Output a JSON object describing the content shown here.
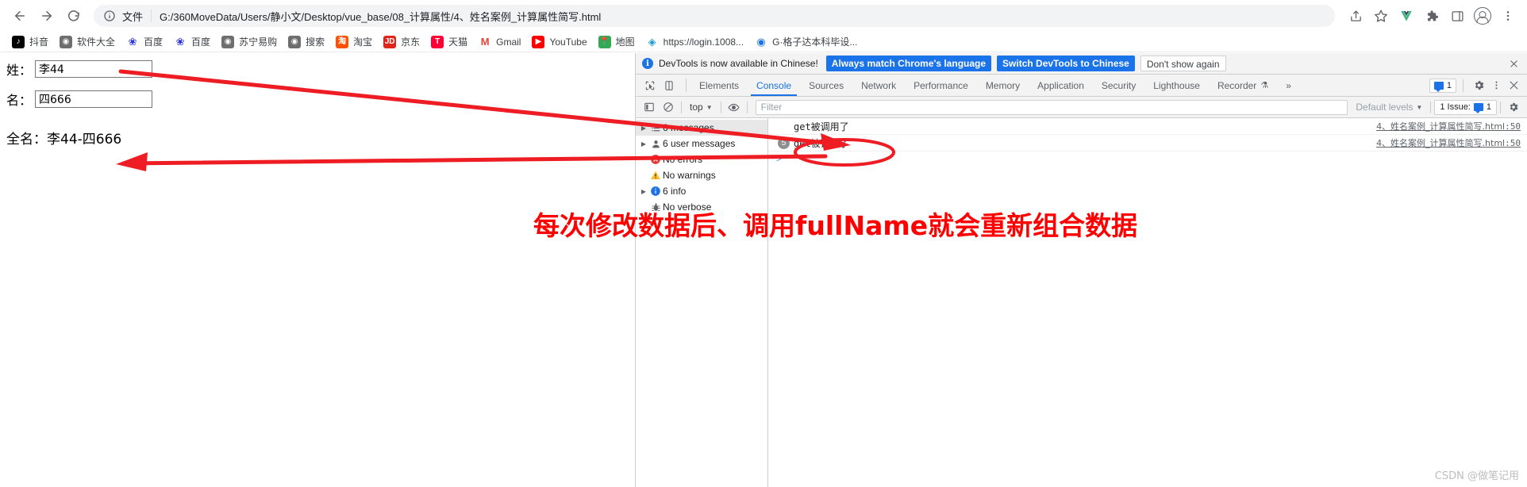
{
  "browser": {
    "nav": {
      "back_label": "Back",
      "forward_label": "Forward",
      "reload_label": "Reload"
    },
    "omnibox": {
      "scheme_label": "文件",
      "url": "G:/360MoveData/Users/静小文/Desktop/vue_base/08_计算属性/4、姓名案例_计算属性简写.html",
      "info_icon": "info-circle-icon"
    },
    "toolbar_right": [
      {
        "name": "share-icon",
        "glyph": "⇪"
      },
      {
        "name": "bookmark-star-icon",
        "glyph": "☆"
      },
      {
        "name": "vue-devtools-icon",
        "glyph": "V"
      },
      {
        "name": "extensions-puzzle-icon",
        "glyph": "🧩"
      },
      {
        "name": "sidebar-panel-icon",
        "glyph": "▤"
      },
      {
        "name": "profile-avatar-icon",
        "glyph": ""
      },
      {
        "name": "chrome-menu-icon",
        "glyph": "⋮"
      }
    ],
    "bookmarks": [
      {
        "label": "抖音",
        "icon": "douyin-icon",
        "bg": "#000000",
        "fg": "#ffffff",
        "char": "♪"
      },
      {
        "label": "软件大全",
        "icon": "globe-icon",
        "bg": "#6e6e6e",
        "fg": "#ffffff",
        "char": "◉"
      },
      {
        "label": "百度",
        "icon": "baidu-icon",
        "bg": "#ffffff",
        "fg": "#2932e1",
        "char": "❀"
      },
      {
        "label": "百度",
        "icon": "baidu-icon",
        "bg": "#ffffff",
        "fg": "#2932e1",
        "char": "❀"
      },
      {
        "label": "苏宁易购",
        "icon": "globe-icon",
        "bg": "#6e6e6e",
        "fg": "#ffffff",
        "char": "◉"
      },
      {
        "label": "搜索",
        "icon": "globe-icon",
        "bg": "#6e6e6e",
        "fg": "#ffffff",
        "char": "◉"
      },
      {
        "label": "淘宝",
        "icon": "taobao-icon",
        "bg": "#ff5000",
        "fg": "#ffffff",
        "char": "淘"
      },
      {
        "label": "京东",
        "icon": "jd-icon",
        "bg": "#e1251b",
        "fg": "#ffffff",
        "char": "JD"
      },
      {
        "label": "天猫",
        "icon": "tmall-icon",
        "bg": "#ff0036",
        "fg": "#ffffff",
        "char": "T"
      },
      {
        "label": "Gmail",
        "icon": "gmail-icon",
        "bg": "#ffffff",
        "fg": "#ea4335",
        "char": "M"
      },
      {
        "label": "YouTube",
        "icon": "youtube-icon",
        "bg": "#ff0000",
        "fg": "#ffffff",
        "char": "▶"
      },
      {
        "label": "地图",
        "icon": "maps-icon",
        "bg": "#34a853",
        "fg": "#ffffff",
        "char": "📍"
      },
      {
        "label": "https://login.1008...",
        "icon": "globe-icon",
        "bg": "#ffffff",
        "fg": "#1a9ad0",
        "char": "◈"
      },
      {
        "label": "G·格子达本科毕设...",
        "icon": "globe-icon",
        "bg": "#ffffff",
        "fg": "#1a73e8",
        "char": "◉"
      }
    ]
  },
  "page": {
    "fields": [
      {
        "label": "姓：",
        "value": "李44",
        "name": "first-name-input"
      },
      {
        "label": "名：",
        "value": "四666",
        "name": "last-name-input"
      }
    ],
    "fullname_label": "全名：",
    "fullname_value": "李44-四666"
  },
  "devtools": {
    "banner": {
      "info_icon": "info-circle-icon",
      "text": "DevTools is now available in Chinese!",
      "btn_always": "Always match Chrome's language",
      "btn_switch": "Switch DevTools to Chinese",
      "btn_dismiss": "Don't show again",
      "close_icon": "close-icon"
    },
    "tools": [
      {
        "label": "",
        "icon": "inspect-element-icon"
      },
      {
        "label": "",
        "icon": "device-toolbar-icon"
      }
    ],
    "tabs": [
      {
        "label": "Elements",
        "active": false
      },
      {
        "label": "Console",
        "active": true
      },
      {
        "label": "Sources",
        "active": false
      },
      {
        "label": "Network",
        "active": false
      },
      {
        "label": "Performance",
        "active": false
      },
      {
        "label": "Memory",
        "active": false
      },
      {
        "label": "Application",
        "active": false
      },
      {
        "label": "Security",
        "active": false
      },
      {
        "label": "Lighthouse",
        "active": false
      },
      {
        "label": "Recorder",
        "active": false,
        "beaker": "⚗"
      }
    ],
    "tabs_overflow": "»",
    "header_right": {
      "messages_count": "1",
      "settings_icon": "gear-icon",
      "more_icon": "kebab-menu-icon",
      "close_icon": "close-icon"
    },
    "console_toolbar": {
      "sidebar_toggle_icon": "console-sidebar-toggle-icon",
      "clear_icon": "clear-console-icon",
      "context_value": "top",
      "eye_icon": "live-expression-eye-icon",
      "filter_placeholder": "Filter",
      "levels_value": "Default levels",
      "issues_label": "1 Issue:",
      "issues_count": "1"
    },
    "sidebar": [
      {
        "label": "6 messages",
        "icon": "list-icon",
        "arrow": true,
        "selected": true
      },
      {
        "label": "6 user messages",
        "icon": "user-icon",
        "arrow": true,
        "selected": false
      },
      {
        "label": "No errors",
        "icon": "error-icon",
        "arrow": false,
        "selected": false
      },
      {
        "label": "No warnings",
        "icon": "warning-icon",
        "arrow": false,
        "selected": false
      },
      {
        "label": "6 info",
        "icon": "info-icon",
        "arrow": true,
        "selected": false
      },
      {
        "label": "No verbose",
        "icon": "verbose-bug-icon",
        "arrow": false,
        "selected": false
      }
    ],
    "logs": [
      {
        "badge": "",
        "text": "get被调用了",
        "source": "4、姓名案例_计算属性简写.html",
        "line": ":50"
      },
      {
        "badge": "5",
        "text": "get被调用了",
        "source": "4、姓名案例_计算属性简写.html",
        "line": ":50"
      }
    ]
  },
  "annotation": {
    "note": "每次修改数据后、调用fullName就会重新组合数据",
    "color": "#ff0000"
  },
  "watermark": "CSDN @做笔记用"
}
